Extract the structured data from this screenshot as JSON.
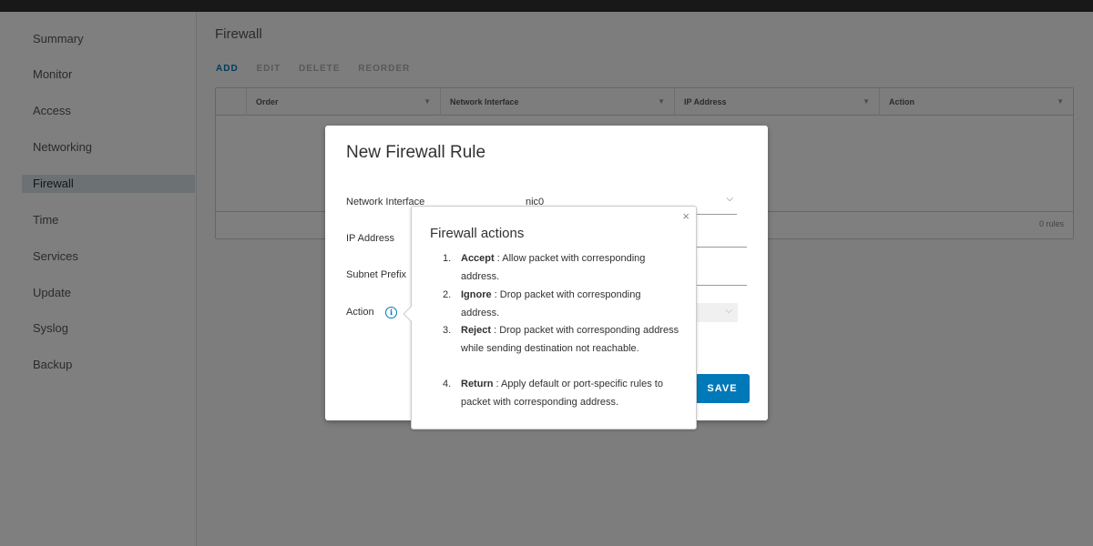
{
  "sidebar": {
    "items": [
      {
        "label": "Summary"
      },
      {
        "label": "Monitor"
      },
      {
        "label": "Access"
      },
      {
        "label": "Networking"
      },
      {
        "label": "Firewall",
        "active": true
      },
      {
        "label": "Time"
      },
      {
        "label": "Services"
      },
      {
        "label": "Update"
      },
      {
        "label": "Syslog"
      },
      {
        "label": "Backup"
      }
    ]
  },
  "page": {
    "title": "Firewall",
    "toolbar": {
      "add": "ADD",
      "edit": "EDIT",
      "delete": "DELETE",
      "reorder": "REORDER"
    },
    "grid": {
      "columns": [
        "Order",
        "Network Interface",
        "IP Address",
        "Action"
      ],
      "footer": "0 rules"
    }
  },
  "modal": {
    "title": "New Firewall Rule",
    "network_interface_label": "Network Interface",
    "network_interface_value": "nic0",
    "ip_address_label": "IP Address",
    "subnet_prefix_label": "Subnet Prefix",
    "action_label": "Action",
    "save_label": "SAVE",
    "info_glyph": "i"
  },
  "popover": {
    "title": "Firewall actions",
    "close_glyph": "×",
    "items": [
      {
        "num": "1.",
        "term": "Accept",
        "sep": " : ",
        "desc": " Allow packet with corresponding address."
      },
      {
        "num": "2.",
        "term": "Ignore",
        "sep": " : ",
        "desc": " Drop packet with corresponding address."
      },
      {
        "num": "3.",
        "term": "Reject",
        "sep": " : ",
        "desc": " Drop packet with corresponding address while sending destination not reachable."
      },
      {
        "num": "4.",
        "term": "Return",
        "sep": " : ",
        "desc": " Apply default or port-specific rules to packet with corresponding address."
      }
    ]
  },
  "colors": {
    "accent": "#0079b8",
    "overlay": "rgba(0,0,0,0.5)"
  },
  "icons": {
    "info": "info-icon",
    "close": "close-icon",
    "chevron": "chevron-down-icon",
    "sort": "sort-arrow-icon"
  }
}
